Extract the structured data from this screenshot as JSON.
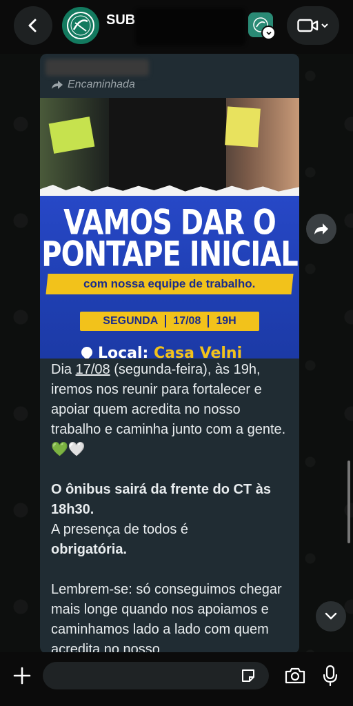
{
  "header": {
    "title": "SUB",
    "back_icon": "chevron-left-icon",
    "video_icon": "video-camera-icon"
  },
  "message": {
    "forwarded_label": "Encaminhada",
    "flyer": {
      "headline_line1": "VAMOS DAR O",
      "headline_line2": "PONTAPE INICIAL",
      "banner": "com nossa equipe de trabalho.",
      "day": "SEGUNDA",
      "date": "17/08",
      "time": "19H",
      "local_label": "Local:",
      "local_place": "Casa Velni"
    },
    "body": {
      "p1_start": "Dia ",
      "p1_date": "17/08",
      "p1_rest": " (segunda-feira), às 19h, iremos nos reunir para fortalecer e apoiar quem acredita no nosso trabalho e caminha junto com a gente. 💚🤍",
      "p2_bold": "O ônibus sairá da frente do CT às 18h30.",
      "p2_text": "A presença de todos é",
      "p2_bold2": "obrigatória.",
      "p3": "Lembrem-se: só conseguimos chegar mais longe quando nos apoiamos e caminhamos lado a lado com quem acredita no nosso"
    }
  },
  "input": {
    "placeholder": ""
  },
  "colors": {
    "bubble": "#202c33",
    "flyer_blue": "#1f3fb2",
    "flyer_yellow": "#f2c21b",
    "avatar_green": "#137a5f"
  }
}
